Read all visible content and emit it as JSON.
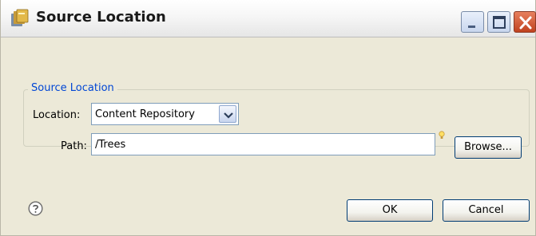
{
  "window": {
    "title": "Source Location",
    "icon": "source-location-icon",
    "controls": [
      "minimize-icon",
      "maximize-icon",
      "close-icon"
    ]
  },
  "group": {
    "legend": "Source Location",
    "location_label": "Location:",
    "location_value": "Content Repository",
    "path_label": "Path:",
    "path_value": "/Trees",
    "browse_label": "Browse..."
  },
  "footer": {
    "help_icon": "help-icon",
    "ok_label": "OK",
    "cancel_label": "Cancel"
  },
  "colors": {
    "accent": "#0046d5",
    "dialog_background": "#ece9d8",
    "close_button": "#c0421f"
  }
}
